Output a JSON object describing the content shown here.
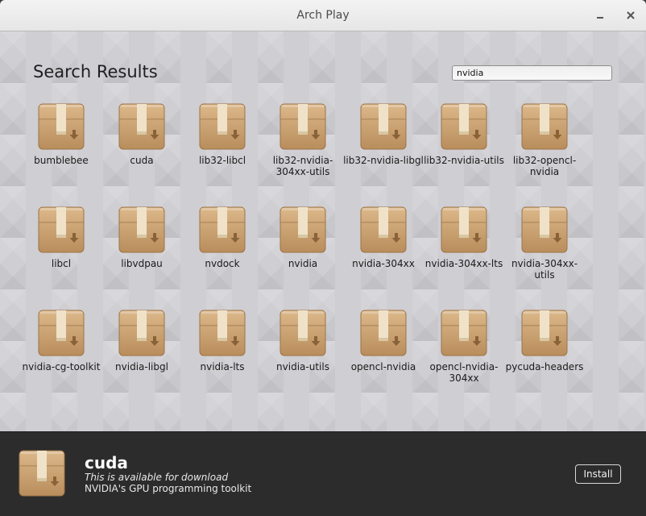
{
  "window": {
    "title": "Arch Play"
  },
  "titlebar": {
    "minimize_icon": "minimize-icon",
    "close_icon": "close-icon"
  },
  "search": {
    "heading": "Search Results",
    "query": "nvidia"
  },
  "packages": [
    {
      "name": "bumblebee"
    },
    {
      "name": "cuda"
    },
    {
      "name": "lib32-libcl"
    },
    {
      "name": "lib32-nvidia-304xx-utils"
    },
    {
      "name": "lib32-nvidia-libgl"
    },
    {
      "name": "lib32-nvidia-utils"
    },
    {
      "name": "lib32-opencl-nvidia"
    },
    {
      "name": "libcl"
    },
    {
      "name": "libvdpau"
    },
    {
      "name": "nvdock"
    },
    {
      "name": "nvidia"
    },
    {
      "name": "nvidia-304xx"
    },
    {
      "name": "nvidia-304xx-lts"
    },
    {
      "name": "nvidia-304xx-utils"
    },
    {
      "name": "nvidia-cg-toolkit"
    },
    {
      "name": "nvidia-libgl"
    },
    {
      "name": "nvidia-lts"
    },
    {
      "name": "nvidia-utils"
    },
    {
      "name": "opencl-nvidia"
    },
    {
      "name": "opencl-nvidia-304xx"
    },
    {
      "name": "pycuda-headers"
    }
  ],
  "package_icon": "package-box-icon",
  "selected": {
    "name": "cuda",
    "availability": "This is available for download",
    "description": "NVIDIA's GPU programming toolkit",
    "install_label": "Install"
  },
  "colors": {
    "box_light": "#dcb88a",
    "box_dark": "#b98d5c",
    "tape": "#efe2c8",
    "arrow": "#8a6238"
  }
}
